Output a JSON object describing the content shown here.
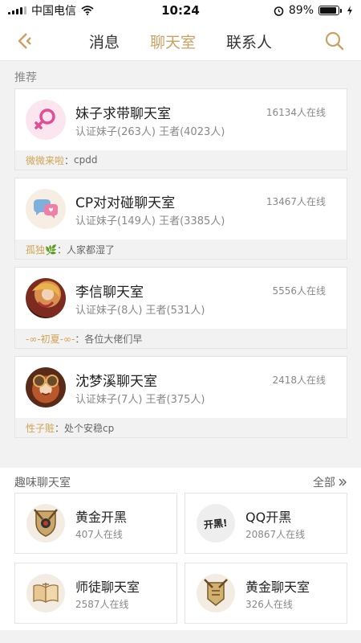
{
  "status_bar": {
    "carrier": "中国电信",
    "time": "10:24",
    "battery_percent": "89%",
    "battery_level": 0.89
  },
  "nav": {
    "tabs": [
      {
        "label": "消息",
        "active": false
      },
      {
        "label": "聊天室",
        "active": true
      },
      {
        "label": "联系人",
        "active": false
      }
    ],
    "accent_color": "#c8a163"
  },
  "recommend": {
    "label": "推荐",
    "rooms": [
      {
        "title": "妹子求带聊天室",
        "sub": "认证妹子(263人) 王者(4023人)",
        "online": "16134人在线",
        "foot_nick": "微微来啦",
        "foot_sep": "：",
        "foot_msg": "cpdd",
        "avatar_icon": "female-symbol-icon"
      },
      {
        "title": "CP对对碰聊天室",
        "sub": "认证妹子(149人) 王者(3385人)",
        "online": "13467人在线",
        "foot_nick": "孤独🌿",
        "foot_sep": "：",
        "foot_msg": "人家都湿了",
        "avatar_icon": "chat-hearts-icon"
      },
      {
        "title": "李信聊天室",
        "sub": "认证妹子(8人) 王者(531人)",
        "online": "5556人在线",
        "foot_nick": "-∞-初夏-∞-",
        "foot_sep": "：",
        "foot_msg": "各位大佬们早",
        "avatar_icon": "hero-portrait-li-xin"
      },
      {
        "title": "沈梦溪聊天室",
        "sub": "认证妹子(7人) 王者(375人)",
        "online": "2418人在线",
        "foot_nick": "性子赃",
        "foot_sep": "：",
        "foot_msg": "处个安稳cp",
        "avatar_icon": "hero-portrait-shen-mengxi"
      }
    ]
  },
  "fun": {
    "label": "趣味聊天室",
    "more": "全部",
    "rooms": [
      {
        "title": "黄金开黑",
        "online": "407人在线",
        "avatar_icon": "gold-shield-icon"
      },
      {
        "title": "QQ开黑",
        "online": "20867人在线",
        "avatar_icon": "kaihei-sticker-icon",
        "sticker_text": "开黑!"
      },
      {
        "title": "师徒聊天室",
        "online": "2587人在线",
        "avatar_icon": "book-icon"
      },
      {
        "title": "黄金聊天室",
        "online": "326人在线",
        "avatar_icon": "gold-banner-icon"
      }
    ]
  }
}
